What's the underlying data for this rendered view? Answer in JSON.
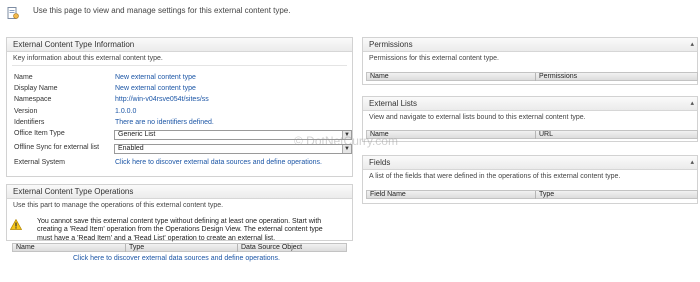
{
  "intro": "Use this page to view and manage settings for this external content type.",
  "info_panel": {
    "title": "External Content Type Information",
    "description": "Key information about this external content type.",
    "fields": {
      "name_label": "Name",
      "name_value": "New external content type",
      "display_name_label": "Display Name",
      "display_name_value": "New external content type",
      "namespace_label": "Namespace",
      "namespace_value": "http://win-v04rsve054t/sites/ss",
      "version_label": "Version",
      "version_value": "1.0.0.0",
      "identifiers_label": "Identifiers",
      "identifiers_value": "There are no identifiers defined.",
      "office_item_type_label": "Office Item Type",
      "office_item_type_value": "Generic List",
      "offline_sync_label": "Offline Sync for external list",
      "offline_sync_value": "Enabled",
      "external_system_label": "External System",
      "external_system_value": "Click here to discover external data sources and define operations."
    }
  },
  "operations_panel": {
    "title": "External Content Type Operations",
    "description": "Use this part to manage the operations of this external content type.",
    "warning": "You cannot save this external content type without defining at least one operation. Start with creating a 'Read Item' operation from the Operations Design View. The external content type must have a 'Read Item' and a 'Read List' operation to create an external list.",
    "columns": [
      "Name",
      "Type",
      "Data Source Object"
    ],
    "link": "Click here to discover external data sources and define operations."
  },
  "permissions_panel": {
    "title": "Permissions",
    "description": "Permissions for this external content type.",
    "columns": [
      "Name",
      "Permissions"
    ]
  },
  "lists_panel": {
    "title": "External Lists",
    "description": "View and navigate to external lists bound to this external content type.",
    "columns": [
      "Name",
      "URL"
    ]
  },
  "fields_panel": {
    "title": "Fields",
    "description": "A list of the fields that were defined in the operations of this external content type.",
    "columns": [
      "Field Name",
      "Type"
    ]
  },
  "watermark": "© DotNetCurry.com",
  "icons": {
    "page": "document-settings-icon",
    "warning": "warning-icon",
    "collapse": "collapse-arrow-icon",
    "dropdown": "dropdown-arrow-icon"
  }
}
